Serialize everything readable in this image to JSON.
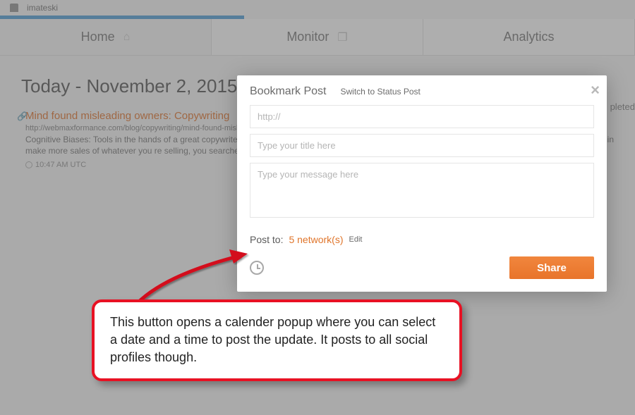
{
  "user": {
    "name": "imateski"
  },
  "tabs": {
    "home": "Home",
    "monitor": "Monitor",
    "analytics": "Analytics"
  },
  "feed": {
    "date_heading": "Today - November 2, 2015",
    "right_label": "pleted",
    "item": {
      "title": "Mind found misleading owners: Copywriting",
      "url": "http://webmaxformance.com/blog/copywriting/mind-found-misl",
      "desc_line1": "Cognitive Biases: Tools in the hands of a great copywriter",
      "desc_line2": "make more sales of whatever you re selling, you searched",
      "desc_suffix": "online in",
      "time": "10:47 AM UTC"
    }
  },
  "modal": {
    "title": "Bookmark Post",
    "switch_link": "Switch to Status Post",
    "url_placeholder": "http://",
    "title_placeholder": "Type your title here",
    "message_placeholder": "Type your message here",
    "post_to_label": "Post to:",
    "network_count": "5 network(s)",
    "edit_label": "Edit",
    "share_label": "Share"
  },
  "callout": {
    "text": "This button opens a calender popup where you can select a date and a time to post the update. It posts to all social profiles though."
  }
}
